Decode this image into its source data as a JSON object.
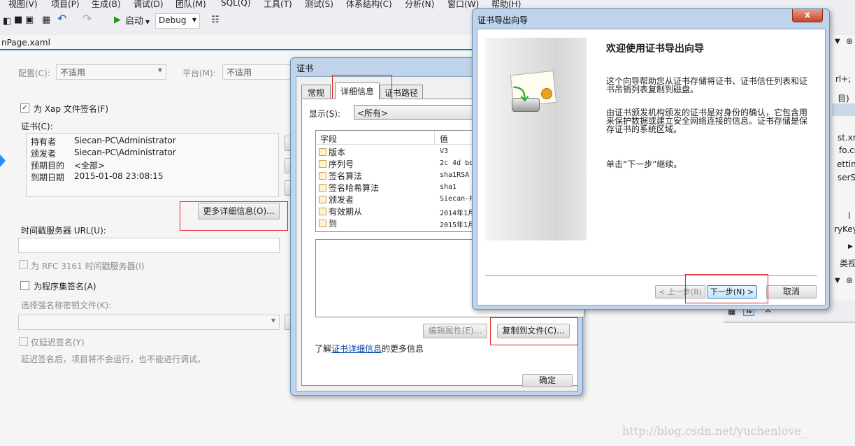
{
  "menu": [
    "视图(V)",
    "项目(P)",
    "生成(B)",
    "调试(D)",
    "团队(M)",
    "SQL(Q)",
    "工具(T)",
    "测试(S)",
    "体系结构(C)",
    "分析(N)",
    "窗口(W)",
    "帮助(H)"
  ],
  "toolbar": {
    "start_label": "启动",
    "config_value": "Debug"
  },
  "doc_tab": "nPage.xaml",
  "project": {
    "config_label": "配置(C):",
    "config_value": "不适用",
    "platform_label": "平台(M):",
    "platform_value": "不适用",
    "sign_xap_label": "为 Xap 文件签名(F)",
    "cert_label": "证书(C):",
    "cert_rows": [
      [
        "持有者",
        "Siecan-PC\\Administrator"
      ],
      [
        "颁发者",
        "Siecan-PC\\Administrator"
      ],
      [
        "预期目的",
        "<全部>"
      ],
      [
        "到期日期",
        "2015-01-08 23:08:15"
      ]
    ],
    "more_details": "更多详细信息(O)...",
    "timestamp_label": "时间戳服务器 URL(U):",
    "rfc_label": "为 RFC 3161 时间戳服务器(I)",
    "sign_assembly_label": "为程序集签名(A)",
    "key_file_label": "选择强名称密钥文件(K):",
    "delay_sign_label": "仅延迟签名(Y)",
    "delay_note": "延迟签名后，项目将不会运行，也不能进行调试。"
  },
  "cert_dialog": {
    "title": "证书",
    "tabs": [
      "常规",
      "详细信息",
      "证书路径"
    ],
    "show_label": "显示(S):",
    "show_value": "<所有>",
    "col_field": "字段",
    "col_value": "值",
    "fields": [
      [
        "版本",
        "V3"
      ],
      [
        "序列号",
        "2c 4d bd"
      ],
      [
        "签名算法",
        "sha1RSA"
      ],
      [
        "签名哈希算法",
        "sha1"
      ],
      [
        "颁发者",
        "Siecan-PC"
      ],
      [
        "有效期从",
        "2014年1月"
      ],
      [
        "到",
        "2015年1月"
      ]
    ],
    "edit_props": "编辑属性(E)...",
    "copy_to_file": "复制到文件(C)...",
    "learn_prefix": "了解",
    "learn_link": "证书详细信息",
    "learn_suffix": "的更多信息",
    "ok": "确定"
  },
  "wizard": {
    "title": "证书导出向导",
    "heading": "欢迎使用证书导出向导",
    "para1": "这个向导帮助您从证书存储将证书、证书信任列表和证书吊销列表复制到磁盘。",
    "para2": "由证书颁发机构颁发的证书是对身份的确认，它包含用来保护数据或建立安全网络连接的信息。证书存储是保存证书的系统区域。",
    "para3": "单击“下一步”继续。",
    "back": "< 上一步(B)",
    "next": "下一步(N) >",
    "cancel": "取消",
    "close": "x"
  },
  "right_pane": {
    "items": [
      "rl+;",
      "目)",
      "st.xml",
      "fo.cs",
      "ettings",
      "serSet",
      "l",
      "ryKey.p",
      "类视"
    ]
  },
  "watermark": "http://blog.csdn.net/yuchenlove_"
}
